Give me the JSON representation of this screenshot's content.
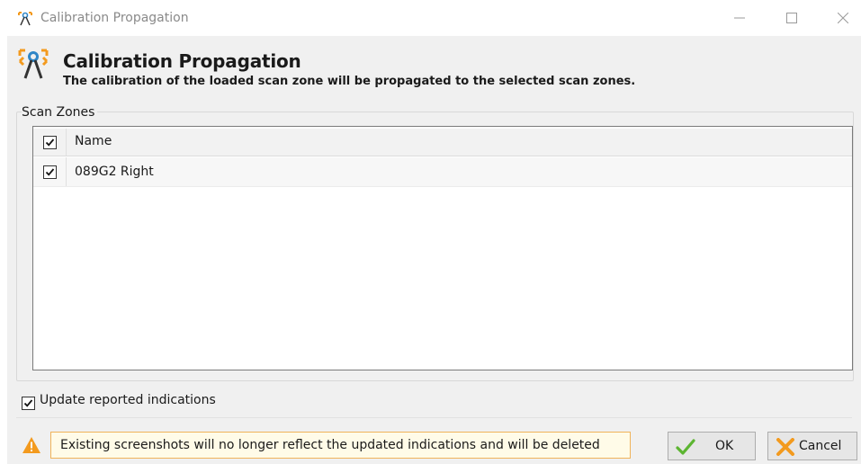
{
  "window": {
    "title": "Calibration Propagation"
  },
  "header": {
    "title": "Calibration Propagation",
    "subtitle": "The calibration of the loaded scan zone will be propagated to the selected scan zones."
  },
  "scan_zones": {
    "group_label": "Scan Zones",
    "columns": [
      "Name"
    ],
    "header_checked": true,
    "rows": [
      {
        "name": "089G2 Right",
        "checked": true
      }
    ]
  },
  "options": {
    "update_label": "Update reported indications",
    "update_checked": true
  },
  "warning": {
    "text": "Existing screenshots will no longer reflect the updated indications and will be deleted"
  },
  "buttons": {
    "ok_label": "OK",
    "cancel_label": "Cancel"
  },
  "icons": {
    "app": "calibration-compass-icon",
    "minimize": "minimize-icon",
    "maximize": "maximize-icon",
    "close": "close-icon",
    "warning": "warning-triangle-icon",
    "ok": "green-check-icon",
    "cancel": "orange-x-icon"
  },
  "colors": {
    "accent_orange": "#f39a1e",
    "accent_blue": "#2f86c7",
    "ok_green": "#5cb531",
    "warning_bg": "#fffbe8",
    "warning_border": "#f0b35a"
  }
}
